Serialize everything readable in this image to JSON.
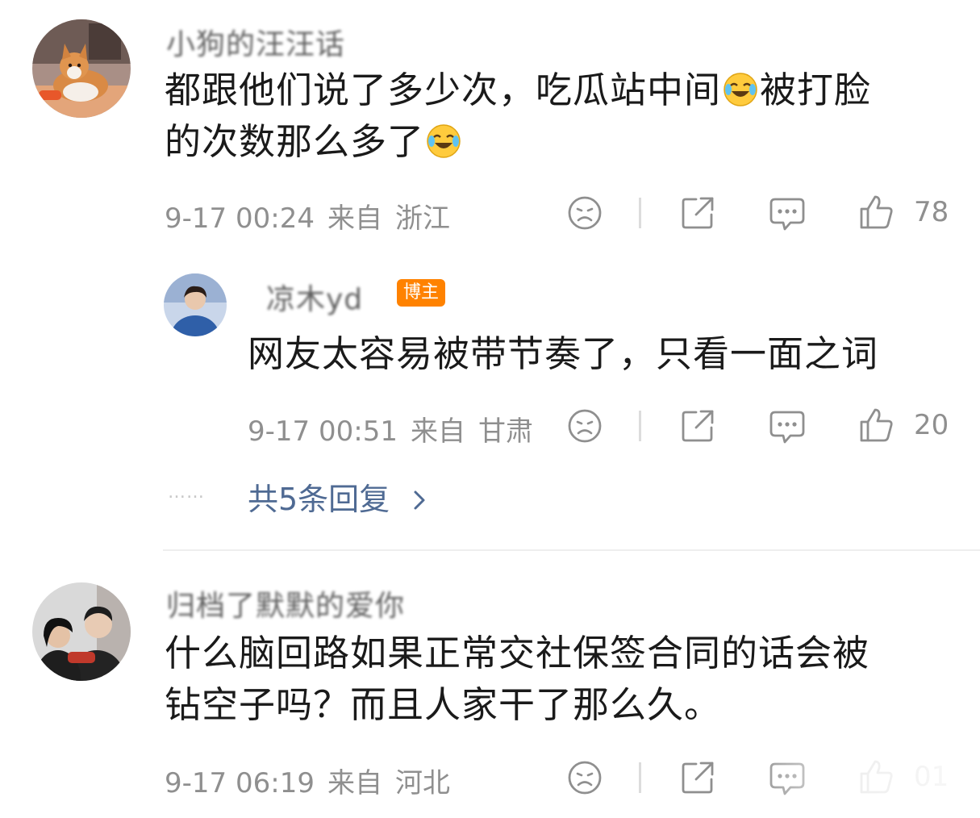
{
  "comments": [
    {
      "username": "小狗的汪汪话",
      "text_parts": [
        "都跟他们说了多少次，吃瓜站中间",
        "被打脸",
        "的次数那么多了"
      ],
      "date": "9-17 00:24",
      "from_label": "来自",
      "location": "浙江",
      "likes": "78"
    },
    {
      "username": "凉木yd",
      "badge": "博主",
      "text": "网友太容易被带节奏了，只看一面之词",
      "date": "9-17 00:51",
      "from_label": "来自",
      "location": "甘肃",
      "likes": "20"
    },
    {
      "username": "归档了默默的爱你",
      "text_lines": [
        "什么脑回路如果正常交社保签合同的话会被",
        "钻空子吗？而且人家干了那么久。"
      ],
      "date": "9-17 06:19",
      "from_label": "来自",
      "location": "河北",
      "likes": "01"
    }
  ],
  "more_replies": {
    "dots": "……",
    "label": "共5条回复"
  },
  "icons": {
    "sad": "sad-face-icon",
    "share": "share-icon",
    "comment": "comment-bubble-icon",
    "like": "thumbs-up-icon",
    "chevron": "chevron-right-icon",
    "laugh_emoji": "laughing-crying-emoji"
  },
  "colors": {
    "badge": "#ff8200",
    "link": "#4f6a93",
    "meta": "#8f8f8f",
    "text": "#1a1a1a"
  }
}
